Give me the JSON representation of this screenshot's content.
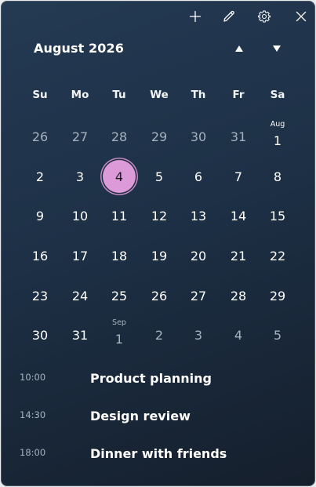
{
  "toolbar": {
    "icons": [
      "plus-icon",
      "pen-icon",
      "gear-icon",
      "close-icon"
    ]
  },
  "header": {
    "month_title": "August 2026",
    "prev_icon": "triangle-up-icon",
    "next_icon": "triangle-down-icon"
  },
  "weekdays": [
    "Su",
    "Mo",
    "Tu",
    "We",
    "Th",
    "Fr",
    "Sa"
  ],
  "weeks": [
    [
      {
        "day": "26",
        "other": true,
        "sub": ""
      },
      {
        "day": "27",
        "other": true,
        "sub": ""
      },
      {
        "day": "28",
        "other": true,
        "sub": ""
      },
      {
        "day": "29",
        "other": true,
        "sub": ""
      },
      {
        "day": "30",
        "other": true,
        "sub": ""
      },
      {
        "day": "31",
        "other": true,
        "sub": ""
      },
      {
        "day": "1",
        "other": false,
        "sub": "Aug"
      }
    ],
    [
      {
        "day": "2",
        "other": false,
        "sub": ""
      },
      {
        "day": "3",
        "other": false,
        "sub": ""
      },
      {
        "day": "4",
        "other": false,
        "sub": "",
        "selected": true
      },
      {
        "day": "5",
        "other": false,
        "sub": ""
      },
      {
        "day": "6",
        "other": false,
        "sub": ""
      },
      {
        "day": "7",
        "other": false,
        "sub": ""
      },
      {
        "day": "8",
        "other": false,
        "sub": ""
      }
    ],
    [
      {
        "day": "9",
        "other": false,
        "sub": ""
      },
      {
        "day": "10",
        "other": false,
        "sub": ""
      },
      {
        "day": "11",
        "other": false,
        "sub": ""
      },
      {
        "day": "12",
        "other": false,
        "sub": ""
      },
      {
        "day": "13",
        "other": false,
        "sub": ""
      },
      {
        "day": "14",
        "other": false,
        "sub": ""
      },
      {
        "day": "15",
        "other": false,
        "sub": ""
      }
    ],
    [
      {
        "day": "16",
        "other": false,
        "sub": ""
      },
      {
        "day": "17",
        "other": false,
        "sub": ""
      },
      {
        "day": "18",
        "other": false,
        "sub": ""
      },
      {
        "day": "19",
        "other": false,
        "sub": ""
      },
      {
        "day": "20",
        "other": false,
        "sub": ""
      },
      {
        "day": "21",
        "other": false,
        "sub": ""
      },
      {
        "day": "22",
        "other": false,
        "sub": ""
      }
    ],
    [
      {
        "day": "23",
        "other": false,
        "sub": ""
      },
      {
        "day": "24",
        "other": false,
        "sub": ""
      },
      {
        "day": "25",
        "other": false,
        "sub": ""
      },
      {
        "day": "26",
        "other": false,
        "sub": ""
      },
      {
        "day": "27",
        "other": false,
        "sub": ""
      },
      {
        "day": "28",
        "other": false,
        "sub": ""
      },
      {
        "day": "29",
        "other": false,
        "sub": ""
      }
    ],
    [
      {
        "day": "30",
        "other": false,
        "sub": ""
      },
      {
        "day": "31",
        "other": false,
        "sub": ""
      },
      {
        "day": "1",
        "other": true,
        "sub": "Sep"
      },
      {
        "day": "2",
        "other": true,
        "sub": ""
      },
      {
        "day": "3",
        "other": true,
        "sub": ""
      },
      {
        "day": "4",
        "other": true,
        "sub": ""
      },
      {
        "day": "5",
        "other": true,
        "sub": ""
      }
    ]
  ],
  "events": [
    {
      "time": "10:00",
      "title": "Product planning"
    },
    {
      "time": "14:30",
      "title": "Design review"
    },
    {
      "time": "18:00",
      "title": "Dinner with friends"
    }
  ],
  "colors": {
    "selected_fill": "#dc9ad8",
    "background": "#1d3046",
    "muted_text": "#a7b2bf"
  }
}
